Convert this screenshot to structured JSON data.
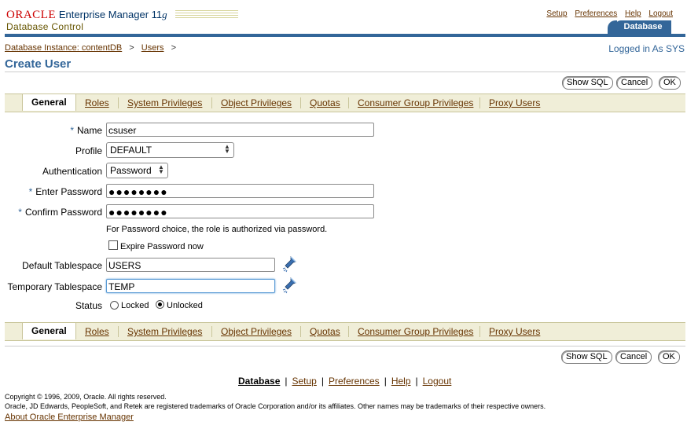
{
  "brand": {
    "oracle": "ORACLE",
    "product": "Enterprise Manager 11",
    "version": "g",
    "subtitle": "Database Control"
  },
  "global_links": [
    "Setup",
    "Preferences",
    "Help",
    "Logout"
  ],
  "target_tab": "Database",
  "breadcrumb": {
    "items": [
      "Database Instance: contentDB",
      "Users"
    ],
    "sep": ">"
  },
  "logged_in": "Logged in As SYS",
  "page_title": "Create User",
  "buttons": {
    "show_sql": "Show SQL",
    "cancel": "Cancel",
    "ok": "OK"
  },
  "tabs": [
    "General",
    "Roles",
    "System Privileges",
    "Object Privileges",
    "Quotas",
    "Consumer Group Privileges",
    "Proxy Users"
  ],
  "form": {
    "name": {
      "required": "*",
      "label": "Name",
      "value": "csuser"
    },
    "profile": {
      "label": "Profile",
      "value": "DEFAULT"
    },
    "authentication": {
      "label": "Authentication",
      "value": "Password"
    },
    "enter_password": {
      "required": "*",
      "label": "Enter Password",
      "value": "●●●●●●●●"
    },
    "confirm_password": {
      "required": "*",
      "label": "Confirm Password",
      "value": "●●●●●●●●"
    },
    "password_note": "For Password choice, the role is authorized via password.",
    "expire_password": {
      "label": "Expire Password now",
      "checked": false
    },
    "default_tablespace": {
      "label": "Default Tablespace",
      "value": "USERS"
    },
    "temporary_tablespace": {
      "label": "Temporary Tablespace",
      "value": "TEMP"
    },
    "status": {
      "label": "Status",
      "options": [
        "Locked",
        "Unlocked"
      ],
      "selected": "Unlocked"
    }
  },
  "footer_links": [
    "Database",
    "Setup",
    "Preferences",
    "Help",
    "Logout"
  ],
  "copyright": [
    "Copyright © 1996, 2009, Oracle. All rights reserved.",
    "Oracle, JD Edwards, PeopleSoft, and Retek are registered trademarks of Oracle Corporation and/or its affiliates. Other names may be trademarks of their respective owners."
  ],
  "about_link": "About Oracle Enterprise Manager",
  "colors": {
    "accent": "#336699",
    "link": "#663300",
    "brand_red": "#cc0000",
    "tabbar_bg": "#f0eed8"
  },
  "icons": {
    "flashlight": "flashlight-search-icon",
    "select_arrows": "select-arrows-icon"
  }
}
